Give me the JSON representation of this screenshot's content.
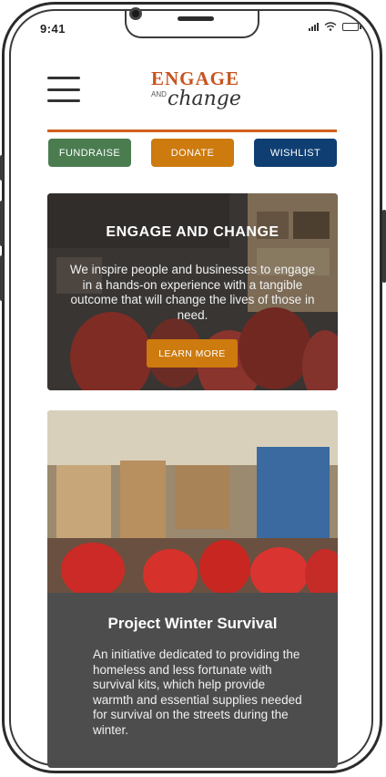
{
  "status_bar": {
    "time": "9:41"
  },
  "header": {
    "menu_icon": "hamburger-icon",
    "logo": {
      "word_engage": "ENGAGE",
      "word_and": "AND",
      "word_change": "change"
    },
    "accent_color": "#d35f1c"
  },
  "action_buttons": [
    {
      "label": "FUNDRAISE",
      "color": "#4a7c50"
    },
    {
      "label": "DONATE",
      "color": "#cd7a0f"
    },
    {
      "label": "WISHLIST",
      "color": "#0f3e72"
    }
  ],
  "hero": {
    "title": "ENGAGE AND CHANGE",
    "body": "We inspire people and businesses to engage in a hands-on experience with a tangible outcome that will change the lives of those in need.",
    "cta_label": "LEARN MORE"
  },
  "project": {
    "title": "Project Winter Survival",
    "body": "An initiative dedicated to providing the homeless and less fortunate with survival kits, which help provide warmth and essential supplies needed for survival on the streets during the winter."
  }
}
